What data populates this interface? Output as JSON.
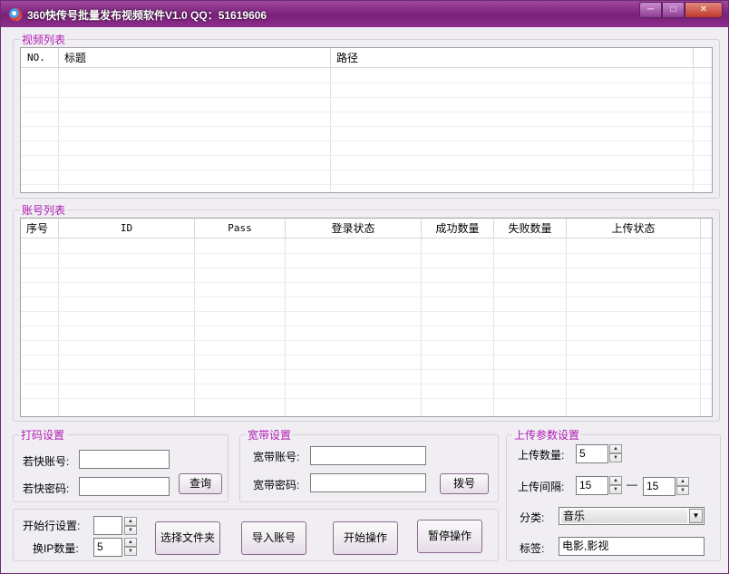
{
  "window": {
    "title": "360快传号批量发布视频软件V1.0 QQ：51619606",
    "minimize": "─",
    "maximize": "□",
    "close": "✕"
  },
  "video_list": {
    "label": "视频列表",
    "columns": [
      "NO.",
      "标题",
      "路径"
    ],
    "rows": []
  },
  "account_list": {
    "label": "账号列表",
    "columns": [
      "序号",
      "ID",
      "Pass",
      "登录状态",
      "成功数量",
      "失败数量",
      "上传状态"
    ],
    "rows": []
  },
  "captcha": {
    "label": "打码设置",
    "account_label": "若快账号:",
    "account_value": "",
    "password_label": "若快密码:",
    "password_value": "",
    "query_button": "查询"
  },
  "broadband": {
    "label": "宽带设置",
    "account_label": "宽带账号:",
    "account_value": "",
    "password_label": "宽带密码:",
    "password_value": "",
    "dial_button": "拨号"
  },
  "upload": {
    "label": "上传参数设置",
    "count_label": "上传数量:",
    "count_value": "5",
    "interval_label": "上传间隔:",
    "interval_from": "15",
    "interval_sep": "—",
    "interval_to": "15",
    "category_label": "分类:",
    "category_value": "音乐",
    "tags_label": "标签:",
    "tags_value": "电影,影视"
  },
  "controls": {
    "start_row_label": "开始行设置:",
    "start_row_value": "",
    "ip_count_label": "换IP数量:",
    "ip_count_value": "5",
    "choose_folder": "选择文件夹",
    "import_accounts": "导入账号",
    "start": "开始操作",
    "pause": "暂停操作"
  },
  "colors": {
    "accent": "#b01cb5",
    "titlebar": "#7a1f7a"
  }
}
